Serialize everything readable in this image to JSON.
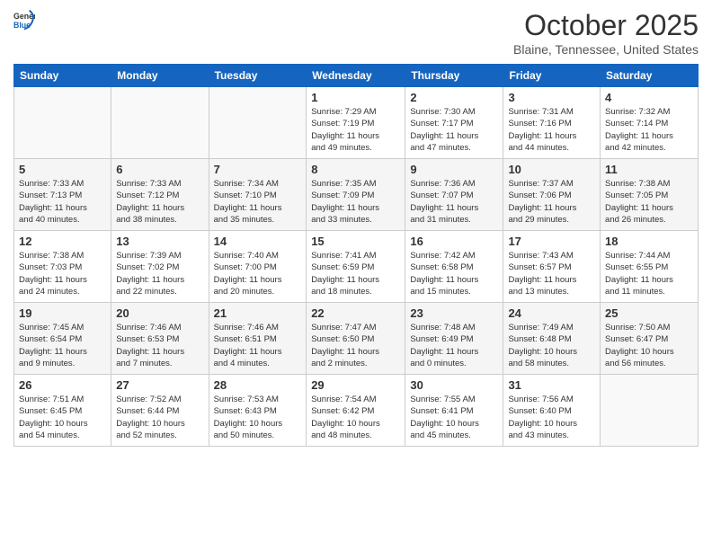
{
  "header": {
    "logo_general": "General",
    "logo_blue": "Blue",
    "month_title": "October 2025",
    "location": "Blaine, Tennessee, United States"
  },
  "days_of_week": [
    "Sunday",
    "Monday",
    "Tuesday",
    "Wednesday",
    "Thursday",
    "Friday",
    "Saturday"
  ],
  "weeks": [
    {
      "days": [
        {
          "number": "",
          "info": ""
        },
        {
          "number": "",
          "info": ""
        },
        {
          "number": "",
          "info": ""
        },
        {
          "number": "1",
          "info": "Sunrise: 7:29 AM\nSunset: 7:19 PM\nDaylight: 11 hours\nand 49 minutes."
        },
        {
          "number": "2",
          "info": "Sunrise: 7:30 AM\nSunset: 7:17 PM\nDaylight: 11 hours\nand 47 minutes."
        },
        {
          "number": "3",
          "info": "Sunrise: 7:31 AM\nSunset: 7:16 PM\nDaylight: 11 hours\nand 44 minutes."
        },
        {
          "number": "4",
          "info": "Sunrise: 7:32 AM\nSunset: 7:14 PM\nDaylight: 11 hours\nand 42 minutes."
        }
      ]
    },
    {
      "days": [
        {
          "number": "5",
          "info": "Sunrise: 7:33 AM\nSunset: 7:13 PM\nDaylight: 11 hours\nand 40 minutes."
        },
        {
          "number": "6",
          "info": "Sunrise: 7:33 AM\nSunset: 7:12 PM\nDaylight: 11 hours\nand 38 minutes."
        },
        {
          "number": "7",
          "info": "Sunrise: 7:34 AM\nSunset: 7:10 PM\nDaylight: 11 hours\nand 35 minutes."
        },
        {
          "number": "8",
          "info": "Sunrise: 7:35 AM\nSunset: 7:09 PM\nDaylight: 11 hours\nand 33 minutes."
        },
        {
          "number": "9",
          "info": "Sunrise: 7:36 AM\nSunset: 7:07 PM\nDaylight: 11 hours\nand 31 minutes."
        },
        {
          "number": "10",
          "info": "Sunrise: 7:37 AM\nSunset: 7:06 PM\nDaylight: 11 hours\nand 29 minutes."
        },
        {
          "number": "11",
          "info": "Sunrise: 7:38 AM\nSunset: 7:05 PM\nDaylight: 11 hours\nand 26 minutes."
        }
      ]
    },
    {
      "days": [
        {
          "number": "12",
          "info": "Sunrise: 7:38 AM\nSunset: 7:03 PM\nDaylight: 11 hours\nand 24 minutes."
        },
        {
          "number": "13",
          "info": "Sunrise: 7:39 AM\nSunset: 7:02 PM\nDaylight: 11 hours\nand 22 minutes."
        },
        {
          "number": "14",
          "info": "Sunrise: 7:40 AM\nSunset: 7:00 PM\nDaylight: 11 hours\nand 20 minutes."
        },
        {
          "number": "15",
          "info": "Sunrise: 7:41 AM\nSunset: 6:59 PM\nDaylight: 11 hours\nand 18 minutes."
        },
        {
          "number": "16",
          "info": "Sunrise: 7:42 AM\nSunset: 6:58 PM\nDaylight: 11 hours\nand 15 minutes."
        },
        {
          "number": "17",
          "info": "Sunrise: 7:43 AM\nSunset: 6:57 PM\nDaylight: 11 hours\nand 13 minutes."
        },
        {
          "number": "18",
          "info": "Sunrise: 7:44 AM\nSunset: 6:55 PM\nDaylight: 11 hours\nand 11 minutes."
        }
      ]
    },
    {
      "days": [
        {
          "number": "19",
          "info": "Sunrise: 7:45 AM\nSunset: 6:54 PM\nDaylight: 11 hours\nand 9 minutes."
        },
        {
          "number": "20",
          "info": "Sunrise: 7:46 AM\nSunset: 6:53 PM\nDaylight: 11 hours\nand 7 minutes."
        },
        {
          "number": "21",
          "info": "Sunrise: 7:46 AM\nSunset: 6:51 PM\nDaylight: 11 hours\nand 4 minutes."
        },
        {
          "number": "22",
          "info": "Sunrise: 7:47 AM\nSunset: 6:50 PM\nDaylight: 11 hours\nand 2 minutes."
        },
        {
          "number": "23",
          "info": "Sunrise: 7:48 AM\nSunset: 6:49 PM\nDaylight: 11 hours\nand 0 minutes."
        },
        {
          "number": "24",
          "info": "Sunrise: 7:49 AM\nSunset: 6:48 PM\nDaylight: 10 hours\nand 58 minutes."
        },
        {
          "number": "25",
          "info": "Sunrise: 7:50 AM\nSunset: 6:47 PM\nDaylight: 10 hours\nand 56 minutes."
        }
      ]
    },
    {
      "days": [
        {
          "number": "26",
          "info": "Sunrise: 7:51 AM\nSunset: 6:45 PM\nDaylight: 10 hours\nand 54 minutes."
        },
        {
          "number": "27",
          "info": "Sunrise: 7:52 AM\nSunset: 6:44 PM\nDaylight: 10 hours\nand 52 minutes."
        },
        {
          "number": "28",
          "info": "Sunrise: 7:53 AM\nSunset: 6:43 PM\nDaylight: 10 hours\nand 50 minutes."
        },
        {
          "number": "29",
          "info": "Sunrise: 7:54 AM\nSunset: 6:42 PM\nDaylight: 10 hours\nand 48 minutes."
        },
        {
          "number": "30",
          "info": "Sunrise: 7:55 AM\nSunset: 6:41 PM\nDaylight: 10 hours\nand 45 minutes."
        },
        {
          "number": "31",
          "info": "Sunrise: 7:56 AM\nSunset: 6:40 PM\nDaylight: 10 hours\nand 43 minutes."
        },
        {
          "number": "",
          "info": ""
        }
      ]
    }
  ]
}
